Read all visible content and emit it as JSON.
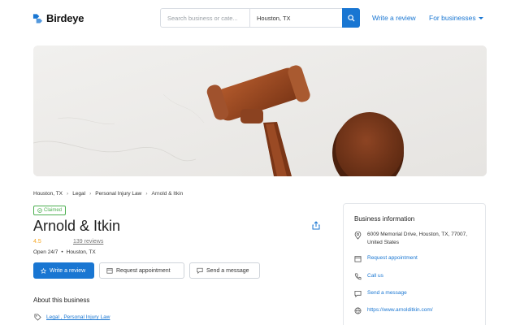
{
  "header": {
    "logo_text": "Birdeye",
    "search_business_placeholder": "Search business or cate...",
    "search_location_value": "Houston, TX",
    "write_review": "Write a review",
    "for_businesses": "For businesses"
  },
  "breadcrumb": [
    "Houston, TX",
    "Legal",
    "Personal Injury Law",
    "Arnold & Itkin"
  ],
  "business": {
    "claimed": "Claimed",
    "name": "Arnold & Itkin",
    "rating": "4.5",
    "reviews": "139 reviews",
    "hours": "Open 24/7",
    "location": "Houston, TX"
  },
  "actions": {
    "write_review": "Write a review",
    "request_appointment": "Request appointment",
    "send_message": "Send a message"
  },
  "about": {
    "heading": "About this business",
    "categories": "Legal , Personal Injury Law"
  },
  "info_panel": {
    "heading": "Business information",
    "address": "6009 Memorial Drive, Houston, TX, 77007, United States",
    "request_appointment": "Request appointment",
    "call": "Call us",
    "message": "Send a message",
    "website": "https://www.arnolditkin.com/"
  },
  "colors": {
    "accent": "#1976d2",
    "rating": "#f5a623",
    "claimed": "#4caf50"
  },
  "icons": [
    "search-icon",
    "share-icon",
    "star-icon",
    "calendar-icon",
    "chat-icon",
    "tag-icon",
    "location-pin-icon",
    "phone-icon",
    "globe-icon"
  ]
}
